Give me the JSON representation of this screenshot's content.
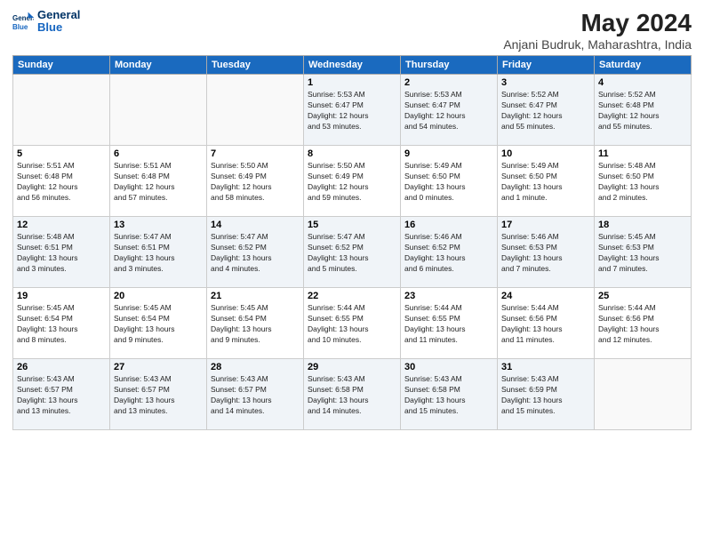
{
  "logo": {
    "line1": "General",
    "line2": "Blue"
  },
  "title": "May 2024",
  "subtitle": "Anjani Budruk, Maharashtra, India",
  "days_of_week": [
    "Sunday",
    "Monday",
    "Tuesday",
    "Wednesday",
    "Thursday",
    "Friday",
    "Saturday"
  ],
  "weeks": [
    [
      {
        "day": "",
        "info": ""
      },
      {
        "day": "",
        "info": ""
      },
      {
        "day": "",
        "info": ""
      },
      {
        "day": "1",
        "info": "Sunrise: 5:53 AM\nSunset: 6:47 PM\nDaylight: 12 hours\nand 53 minutes."
      },
      {
        "day": "2",
        "info": "Sunrise: 5:53 AM\nSunset: 6:47 PM\nDaylight: 12 hours\nand 54 minutes."
      },
      {
        "day": "3",
        "info": "Sunrise: 5:52 AM\nSunset: 6:47 PM\nDaylight: 12 hours\nand 55 minutes."
      },
      {
        "day": "4",
        "info": "Sunrise: 5:52 AM\nSunset: 6:48 PM\nDaylight: 12 hours\nand 55 minutes."
      }
    ],
    [
      {
        "day": "5",
        "info": "Sunrise: 5:51 AM\nSunset: 6:48 PM\nDaylight: 12 hours\nand 56 minutes."
      },
      {
        "day": "6",
        "info": "Sunrise: 5:51 AM\nSunset: 6:48 PM\nDaylight: 12 hours\nand 57 minutes."
      },
      {
        "day": "7",
        "info": "Sunrise: 5:50 AM\nSunset: 6:49 PM\nDaylight: 12 hours\nand 58 minutes."
      },
      {
        "day": "8",
        "info": "Sunrise: 5:50 AM\nSunset: 6:49 PM\nDaylight: 12 hours\nand 59 minutes."
      },
      {
        "day": "9",
        "info": "Sunrise: 5:49 AM\nSunset: 6:50 PM\nDaylight: 13 hours\nand 0 minutes."
      },
      {
        "day": "10",
        "info": "Sunrise: 5:49 AM\nSunset: 6:50 PM\nDaylight: 13 hours\nand 1 minute."
      },
      {
        "day": "11",
        "info": "Sunrise: 5:48 AM\nSunset: 6:50 PM\nDaylight: 13 hours\nand 2 minutes."
      }
    ],
    [
      {
        "day": "12",
        "info": "Sunrise: 5:48 AM\nSunset: 6:51 PM\nDaylight: 13 hours\nand 3 minutes."
      },
      {
        "day": "13",
        "info": "Sunrise: 5:47 AM\nSunset: 6:51 PM\nDaylight: 13 hours\nand 3 minutes."
      },
      {
        "day": "14",
        "info": "Sunrise: 5:47 AM\nSunset: 6:52 PM\nDaylight: 13 hours\nand 4 minutes."
      },
      {
        "day": "15",
        "info": "Sunrise: 5:47 AM\nSunset: 6:52 PM\nDaylight: 13 hours\nand 5 minutes."
      },
      {
        "day": "16",
        "info": "Sunrise: 5:46 AM\nSunset: 6:52 PM\nDaylight: 13 hours\nand 6 minutes."
      },
      {
        "day": "17",
        "info": "Sunrise: 5:46 AM\nSunset: 6:53 PM\nDaylight: 13 hours\nand 7 minutes."
      },
      {
        "day": "18",
        "info": "Sunrise: 5:45 AM\nSunset: 6:53 PM\nDaylight: 13 hours\nand 7 minutes."
      }
    ],
    [
      {
        "day": "19",
        "info": "Sunrise: 5:45 AM\nSunset: 6:54 PM\nDaylight: 13 hours\nand 8 minutes."
      },
      {
        "day": "20",
        "info": "Sunrise: 5:45 AM\nSunset: 6:54 PM\nDaylight: 13 hours\nand 9 minutes."
      },
      {
        "day": "21",
        "info": "Sunrise: 5:45 AM\nSunset: 6:54 PM\nDaylight: 13 hours\nand 9 minutes."
      },
      {
        "day": "22",
        "info": "Sunrise: 5:44 AM\nSunset: 6:55 PM\nDaylight: 13 hours\nand 10 minutes."
      },
      {
        "day": "23",
        "info": "Sunrise: 5:44 AM\nSunset: 6:55 PM\nDaylight: 13 hours\nand 11 minutes."
      },
      {
        "day": "24",
        "info": "Sunrise: 5:44 AM\nSunset: 6:56 PM\nDaylight: 13 hours\nand 11 minutes."
      },
      {
        "day": "25",
        "info": "Sunrise: 5:44 AM\nSunset: 6:56 PM\nDaylight: 13 hours\nand 12 minutes."
      }
    ],
    [
      {
        "day": "26",
        "info": "Sunrise: 5:43 AM\nSunset: 6:57 PM\nDaylight: 13 hours\nand 13 minutes."
      },
      {
        "day": "27",
        "info": "Sunrise: 5:43 AM\nSunset: 6:57 PM\nDaylight: 13 hours\nand 13 minutes."
      },
      {
        "day": "28",
        "info": "Sunrise: 5:43 AM\nSunset: 6:57 PM\nDaylight: 13 hours\nand 14 minutes."
      },
      {
        "day": "29",
        "info": "Sunrise: 5:43 AM\nSunset: 6:58 PM\nDaylight: 13 hours\nand 14 minutes."
      },
      {
        "day": "30",
        "info": "Sunrise: 5:43 AM\nSunset: 6:58 PM\nDaylight: 13 hours\nand 15 minutes."
      },
      {
        "day": "31",
        "info": "Sunrise: 5:43 AM\nSunset: 6:59 PM\nDaylight: 13 hours\nand 15 minutes."
      },
      {
        "day": "",
        "info": ""
      }
    ]
  ]
}
